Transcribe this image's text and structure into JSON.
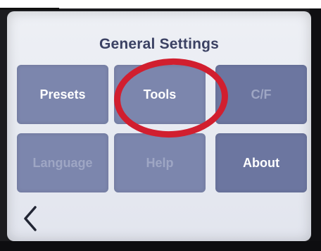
{
  "screen": {
    "title": "General Settings"
  },
  "tiles": [
    {
      "label": "Presets",
      "state": "enabled"
    },
    {
      "label": "Tools",
      "state": "enabled"
    },
    {
      "label": "C/F",
      "state": "disabled"
    },
    {
      "label": "Language",
      "state": "disabled"
    },
    {
      "label": "Help",
      "state": "disabled"
    },
    {
      "label": "About",
      "state": "enabled"
    }
  ],
  "nav": {
    "back_icon": "chevron-left-icon"
  },
  "annotation": {
    "highlight_color": "#d11f2f",
    "highlighted_tile": "Tools"
  },
  "colors": {
    "screen_background": "#eef0f5",
    "tile_background": "#7c86ad",
    "title_text": "#3b4163",
    "enabled_text": "#ffffff",
    "disabled_text": "#9ea6c4"
  }
}
